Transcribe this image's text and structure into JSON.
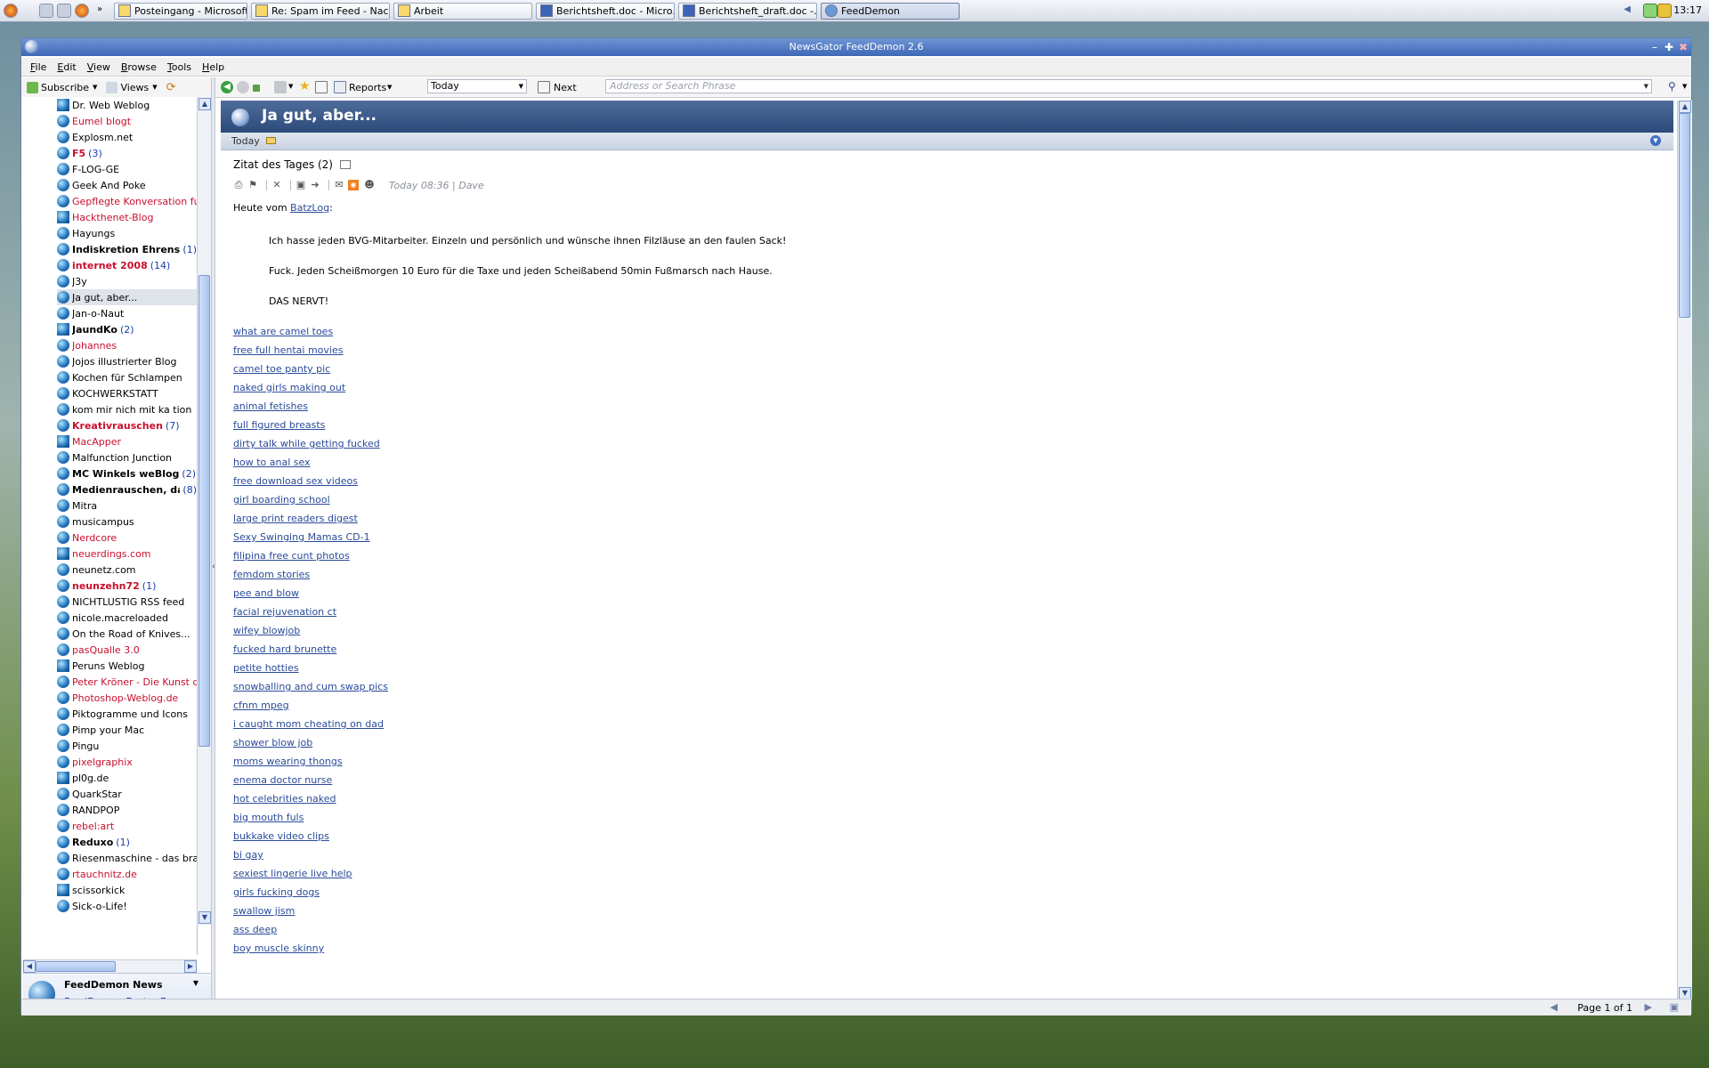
{
  "taskbar": {
    "buttons": [
      {
        "label": "Posteingang - Microsoft ..."
      },
      {
        "label": "Re: Spam im Feed - Nac..."
      },
      {
        "label": "Arbeit"
      },
      {
        "label": "Berichtsheft.doc - Micro..."
      },
      {
        "label": "Berichtsheft_draft.doc -..."
      },
      {
        "label": "FeedDemon"
      }
    ],
    "clock": "13:17"
  },
  "window": {
    "title": "NewsGator FeedDemon 2.6"
  },
  "menu": [
    "File",
    "Edit",
    "View",
    "Browse",
    "Tools",
    "Help"
  ],
  "left_toolbar": {
    "subscribe": "Subscribe",
    "views": "Views"
  },
  "feeds": [
    {
      "name": "Dr. Web Weblog",
      "style": "normal",
      "count": ""
    },
    {
      "name": "Eumel blogt",
      "style": "unread",
      "count": ""
    },
    {
      "name": "Explosm.net",
      "style": "normal",
      "count": ""
    },
    {
      "name": "F5",
      "style": "boldred",
      "count": "(3)"
    },
    {
      "name": "F-LOG-GE",
      "style": "normal",
      "count": ""
    },
    {
      "name": "Geek And Poke",
      "style": "normal",
      "count": ""
    },
    {
      "name": "Gepflegte Konversation fuer",
      "style": "unread",
      "count": ""
    },
    {
      "name": "Hackthenet-Blog",
      "style": "unread",
      "count": ""
    },
    {
      "name": "Hayungs",
      "style": "normal",
      "count": ""
    },
    {
      "name": "Indiskretion Ehrensache",
      "style": "bold",
      "count": "(1)"
    },
    {
      "name": "internet 2008",
      "style": "boldred",
      "count": "(14)"
    },
    {
      "name": "J3y",
      "style": "normal",
      "count": ""
    },
    {
      "name": "Ja gut, aber...",
      "style": "selected",
      "count": ""
    },
    {
      "name": "Jan-o-Naut",
      "style": "normal",
      "count": ""
    },
    {
      "name": "JaundKo",
      "style": "bold",
      "count": "(2)"
    },
    {
      "name": "Johannes",
      "style": "unread",
      "count": ""
    },
    {
      "name": "Jojos illustrierter Blog",
      "style": "normal",
      "count": ""
    },
    {
      "name": "Kochen für Schlampen",
      "style": "normal",
      "count": ""
    },
    {
      "name": "KOCHWERKSTATT",
      "style": "normal",
      "count": ""
    },
    {
      "name": "kom mir nich mit ka tion",
      "style": "normal",
      "count": ""
    },
    {
      "name": "Kreativrauschen",
      "style": "boldred",
      "count": "(7)"
    },
    {
      "name": "MacApper",
      "style": "unread",
      "count": ""
    },
    {
      "name": "Malfunction Junction",
      "style": "normal",
      "count": ""
    },
    {
      "name": "MC Winkels weBlog",
      "style": "bold",
      "count": "(2)"
    },
    {
      "name": "Medienrauschen, da",
      "style": "bold",
      "count": "(8)"
    },
    {
      "name": "Mitra",
      "style": "normal",
      "count": ""
    },
    {
      "name": "musicampus",
      "style": "normal",
      "count": ""
    },
    {
      "name": "Nerdcore",
      "style": "unread",
      "count": ""
    },
    {
      "name": "neuerdings.com",
      "style": "unread",
      "count": ""
    },
    {
      "name": "neunetz.com",
      "style": "normal",
      "count": ""
    },
    {
      "name": "neunzehn72",
      "style": "boldred",
      "count": "(1)"
    },
    {
      "name": "NICHTLUSTIG RSS feed",
      "style": "normal",
      "count": ""
    },
    {
      "name": "nicole.macreloaded",
      "style": "normal",
      "count": ""
    },
    {
      "name": "On the Road of Knives...",
      "style": "normal",
      "count": ""
    },
    {
      "name": "pasQualle 3.0",
      "style": "unread",
      "count": ""
    },
    {
      "name": "Peruns Weblog",
      "style": "normal",
      "count": ""
    },
    {
      "name": "Peter Kröner - Die Kunst des",
      "style": "unread",
      "count": ""
    },
    {
      "name": "Photoshop-Weblog.de",
      "style": "unread",
      "count": ""
    },
    {
      "name": "Piktogramme und Icons",
      "style": "normal",
      "count": ""
    },
    {
      "name": "Pimp your Mac",
      "style": "normal",
      "count": ""
    },
    {
      "name": "Pingu",
      "style": "normal",
      "count": ""
    },
    {
      "name": "pixelgraphix",
      "style": "unread",
      "count": ""
    },
    {
      "name": "pl0g.de",
      "style": "normal",
      "count": ""
    },
    {
      "name": "QuarkStar",
      "style": "normal",
      "count": ""
    },
    {
      "name": "RANDPOP",
      "style": "normal",
      "count": ""
    },
    {
      "name": "rebel:art",
      "style": "unread",
      "count": ""
    },
    {
      "name": "Reduxo",
      "style": "bold",
      "count": "(1)"
    },
    {
      "name": "Riesenmaschine - das brand",
      "style": "normal",
      "count": ""
    },
    {
      "name": "rtauchnitz.de",
      "style": "unread",
      "count": ""
    },
    {
      "name": "scissorkick",
      "style": "normal",
      "count": ""
    },
    {
      "name": "Sick-o-Life!",
      "style": "normal",
      "count": ""
    }
  ],
  "news_panel": {
    "title": "FeedDemon News",
    "link": "FeedDemon Easter Egg"
  },
  "right_toolbar": {
    "reports": "Reports",
    "today_select": "Today",
    "next": "Next",
    "address_placeholder": "Address or Search Phrase"
  },
  "content": {
    "header_title": "Ja gut, aber...",
    "subheader": "Today",
    "article": {
      "title": "Zitat des Tages (2)",
      "meta": "Today 08:36 | Dave",
      "intro_prefix": "Heute vom",
      "intro_link": "BatzLog",
      "intro_suffix": ":",
      "quotes": [
        "Ich hasse jeden BVG-Mitarbeiter. Einzeln und persönlich und wünsche ihnen Filzläuse an den faulen Sack!",
        "Fuck. Jeden Scheißmorgen 10 Euro für die Taxe und jeden Scheißabend 50min Fußmarsch nach Hause.",
        "DAS NERVT!"
      ],
      "spam_links": [
        "what are camel toes",
        "free full hentai movies",
        "camel toe panty pic",
        "naked girls making out",
        "animal fetishes",
        "full figured breasts",
        "dirty talk while getting fucked",
        "how to anal sex",
        "free download sex videos",
        "girl boarding school",
        "large print readers digest",
        "Sexy Swinging Mamas CD-1",
        "filipina free cunt photos",
        "femdom stories",
        "pee and blow",
        "facial rejuvenation ct",
        "wifey blowjob",
        "fucked hard brunette",
        "petite hotties",
        "snowballing and cum swap pics",
        "cfnm mpeg",
        "i caught mom cheating on dad",
        "shower blow job",
        "moms wearing thongs",
        "enema doctor nurse",
        "hot celebrities naked",
        "big mouth fuls",
        "bukkake video clips",
        "bi gay",
        "sexiest lingerie live help",
        "girls fucking dogs",
        "swallow jism",
        "ass deep",
        "boy muscle skinny"
      ]
    }
  },
  "status": {
    "page": "Page 1 of 1"
  }
}
